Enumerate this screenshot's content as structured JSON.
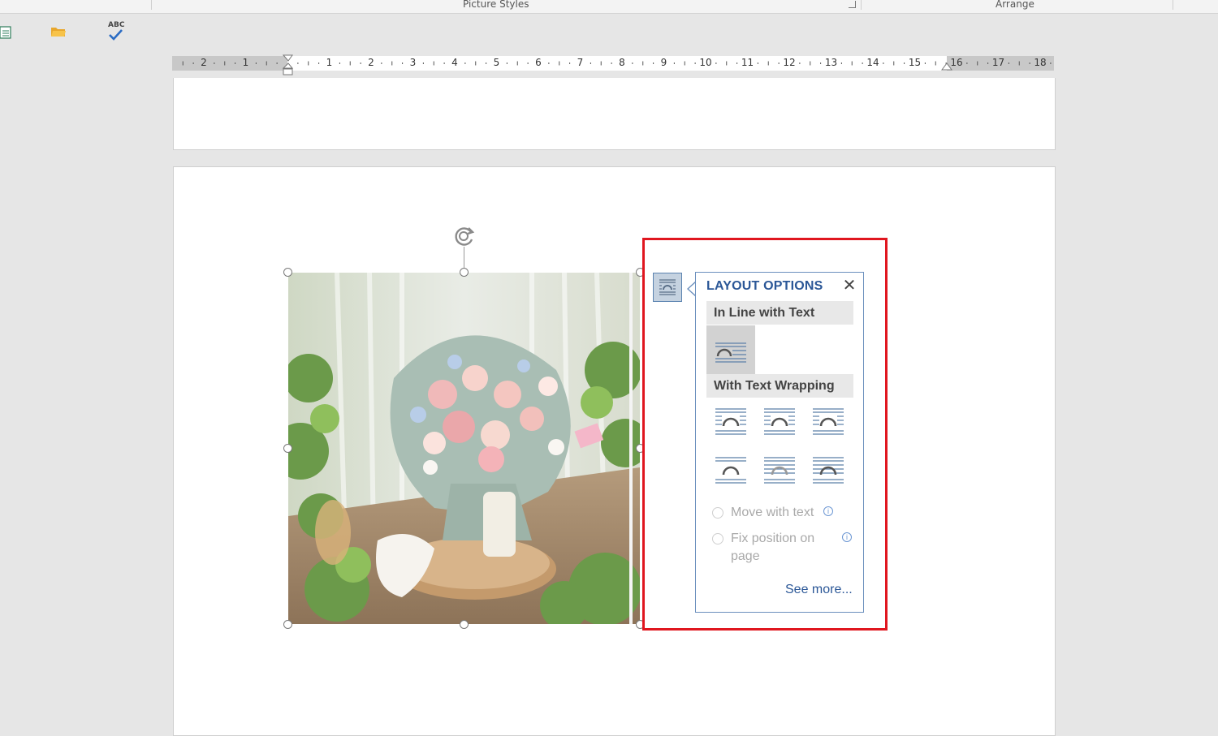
{
  "ribbon": {
    "groups": [
      {
        "label": "Picture Styles"
      },
      {
        "label": "Arrange"
      }
    ]
  },
  "quick_access": {
    "icons": [
      "document-icon",
      "open-folder-icon",
      "spelling-check-icon"
    ],
    "spelling_icon_text": "ABC"
  },
  "ruler": {
    "labels": [
      "2",
      "1",
      "1",
      "2",
      "3",
      "4",
      "5",
      "6",
      "7",
      "8",
      "9",
      "10",
      "11",
      "12",
      "13",
      "14",
      "15",
      "16",
      "17",
      "18"
    ]
  },
  "layout_options": {
    "button_icon": "layout-options-icon",
    "title": "LAYOUT OPTIONS",
    "close_glyph": "✕",
    "inline_section": "In Line with Text",
    "wrapping_section": "With Text Wrapping",
    "wrap_options": [
      "square-wrap-icon",
      "tight-wrap-icon",
      "through-wrap-icon",
      "top-and-bottom-wrap-icon",
      "behind-text-icon",
      "in-front-of-text-icon"
    ],
    "move_with_text": "Move with text",
    "fix_position_line1": "Fix position on",
    "fix_position_line2": "page",
    "info_glyph": "i",
    "see_more": "See more..."
  },
  "colors": {
    "accent": "#2b5797",
    "highlight": "#e0161f",
    "disabled_text": "#a9a9a9"
  }
}
